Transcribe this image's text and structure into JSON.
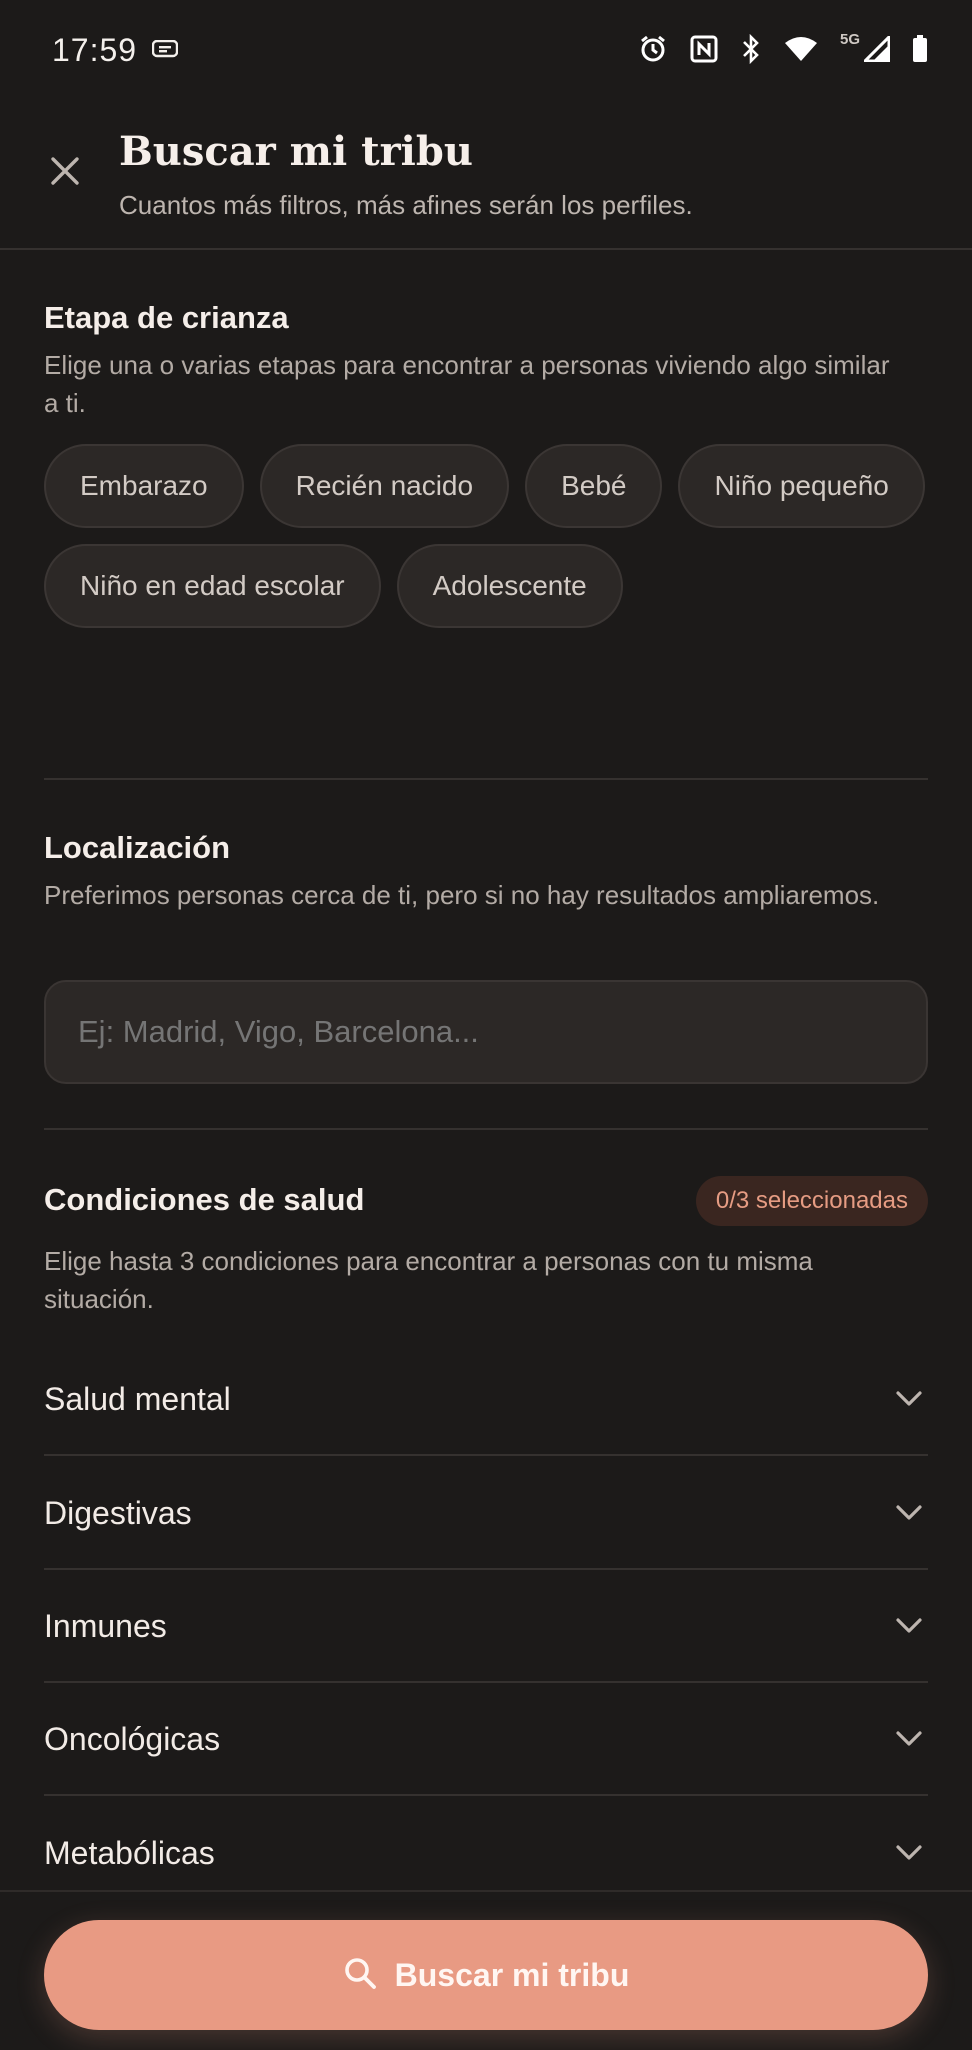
{
  "status_bar": {
    "time": "17:59",
    "network": "5G"
  },
  "header": {
    "title": "Buscar mi tribu",
    "subtitle": "Cuantos más filtros, más afines serán los perfiles."
  },
  "stage": {
    "title": "Etapa de crianza",
    "description": "Elige una o varias etapas para encontrar a personas viviendo algo similar a ti.",
    "chips": [
      "Embarazo",
      "Recién nacido",
      "Bebé",
      "Niño pequeño",
      "Niño en edad escolar",
      "Adolescente"
    ]
  },
  "location": {
    "title": "Localización",
    "description": "Preferimos personas cerca de ti, pero si no hay resultados ampliaremos.",
    "placeholder": "Ej: Madrid, Vigo, Barcelona..."
  },
  "health": {
    "title": "Condiciones de salud",
    "badge": "0/3 seleccionadas",
    "description": "Elige hasta 3 condiciones para encontrar a personas con tu misma situación.",
    "categories": [
      "Salud mental",
      "Digestivas",
      "Inmunes",
      "Oncológicas",
      "Metabólicas"
    ]
  },
  "cta": {
    "label": "Buscar mi tribu",
    "icon": "search-icon"
  },
  "colors": {
    "background": "#1c1a19",
    "accent": "#e89a83",
    "chip_bg": "#2c2826"
  }
}
